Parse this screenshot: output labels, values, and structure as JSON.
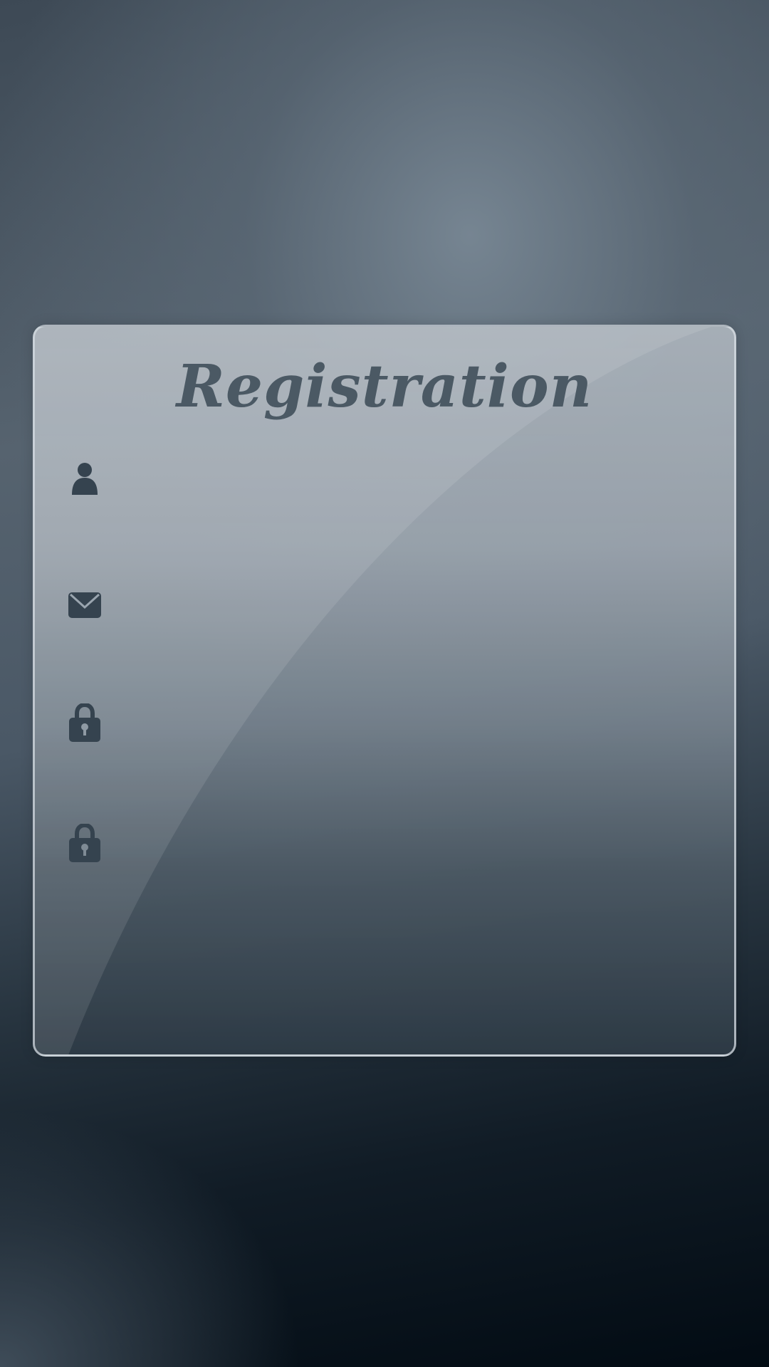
{
  "form": {
    "title": "Registration",
    "fields": [
      {
        "name": "username",
        "icon": "user-icon",
        "value": "",
        "placeholder": ""
      },
      {
        "name": "email",
        "icon": "mail-icon",
        "value": "",
        "placeholder": ""
      },
      {
        "name": "password",
        "icon": "lock-icon",
        "value": "",
        "placeholder": ""
      },
      {
        "name": "confirm-password",
        "icon": "lock-icon",
        "value": "",
        "placeholder": ""
      }
    ]
  },
  "colors": {
    "icon": "#35434f",
    "title": "#4b5964",
    "card_border": "#d7dee4"
  }
}
